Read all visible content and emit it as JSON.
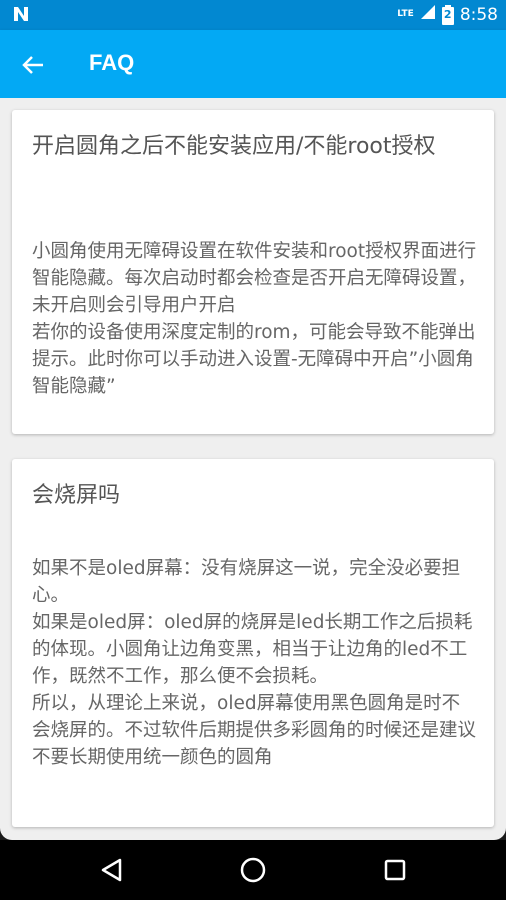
{
  "status_bar": {
    "carrier_icon": "n-icon",
    "network": "LTE",
    "battery_level": "2",
    "time": "8:58"
  },
  "app_bar": {
    "back_icon": "arrow-left-icon",
    "title": "FAQ"
  },
  "faq": [
    {
      "title": "开启圆角之后不能安装应用/不能root授权",
      "body": "小圆角使用无障碍设置在软件安装和root授权界面进行智能隐藏。每次启动时都会检查是否开启无障碍设置，未开启则会引导用户开启\n若你的设备使用深度定制的rom，可能会导致不能弹出提示。此时你可以手动进入设置-无障碍中开启”小圆角智能隐藏”"
    },
    {
      "title": "会烧屏吗",
      "body": "如果不是oled屏幕：没有烧屏这一说，完全没必要担心。\n如果是oled屏：oled屏的烧屏是led长期工作之后损耗的体现。小圆角让边角变黑，相当于让边角的led不工作，既然不工作，那么便不会损耗。\n所以，从理论上来说，oled屏幕使用黑色圆角是时不会烧屏的。不过软件后期提供多彩圆角的时候还是建议不要长期使用统一颜色的圆角"
    }
  ],
  "nav_bar": {
    "back_icon": "triangle-back-icon",
    "home_icon": "circle-home-icon",
    "recents_icon": "square-recents-icon"
  },
  "colors": {
    "status_bar": "#0288D1",
    "app_bar": "#03A9F4",
    "background": "#EFEFEF"
  }
}
